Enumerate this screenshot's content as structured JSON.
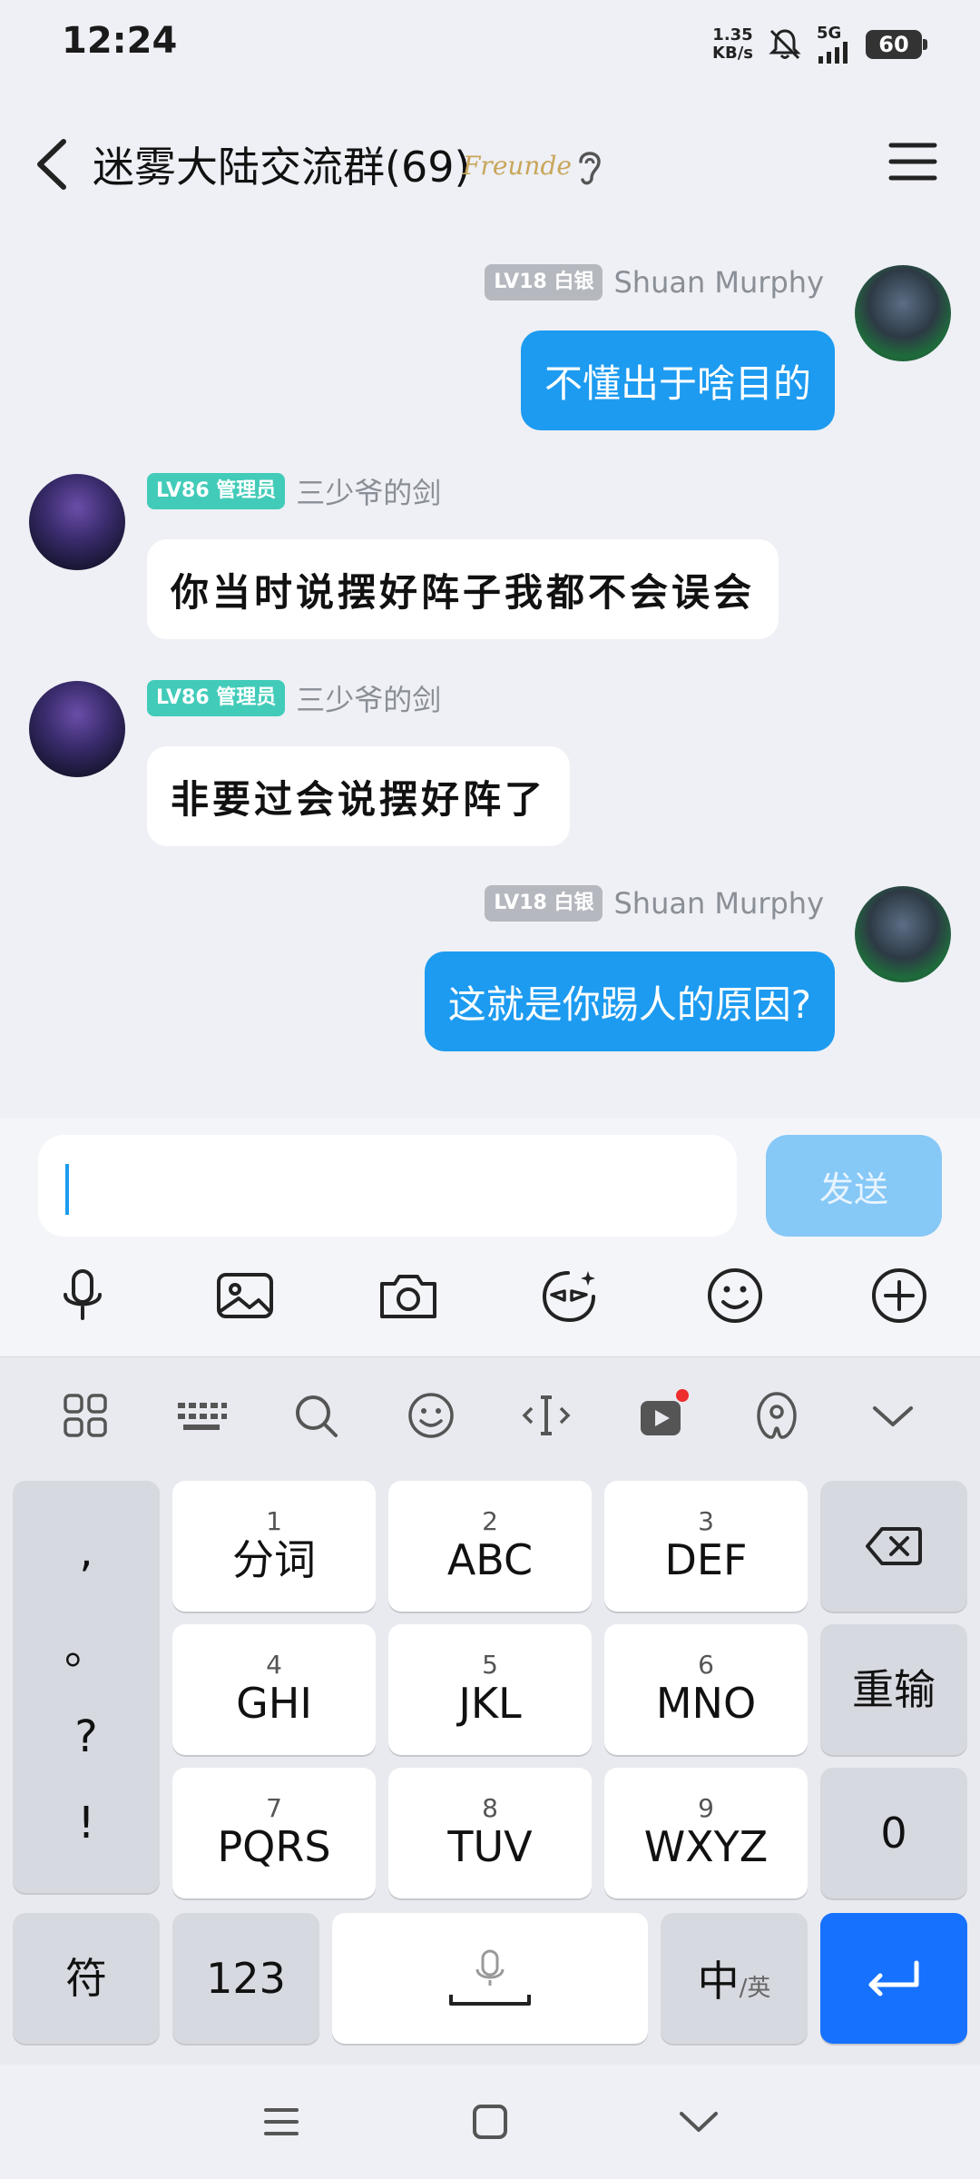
{
  "status": {
    "time": "12:24",
    "net_speed_value": "1.35",
    "net_speed_unit": "KB/s",
    "network": "5G",
    "battery": "60"
  },
  "header": {
    "title": "迷雾大陆交流群(69)",
    "tag": "Freunde"
  },
  "messages": [
    {
      "side": "right",
      "level": "LV18 白银",
      "name": "Shuan Murphy",
      "text": "不懂出于啥目的"
    },
    {
      "side": "left",
      "level": "LV86 管理员",
      "name": "三少爷的剑",
      "text": "你当时说摆好阵子我都不会误会"
    },
    {
      "side": "left",
      "level": "LV86 管理员",
      "name": "三少爷的剑",
      "text": "非要过会说摆好阵了"
    },
    {
      "side": "right",
      "level": "LV18 白银",
      "name": "Shuan Murphy",
      "text": "这就是你踢人的原因?"
    }
  ],
  "input": {
    "send_label": "发送"
  },
  "tools": [
    "microphone-icon",
    "image-icon",
    "camera-icon",
    "sticker-icon",
    "smiley-icon",
    "plus-icon"
  ],
  "keyboard": {
    "toolbar": [
      "grid-icon",
      "keyboard-icon",
      "search-icon",
      "emoji-icon",
      "cursor-icon",
      "video-ad-icon",
      "handle-icon",
      "collapse-icon"
    ],
    "punct": [
      ",",
      "。",
      "?",
      "!"
    ],
    "keys": [
      {
        "num": "1",
        "label": "分词"
      },
      {
        "num": "2",
        "label": "ABC"
      },
      {
        "num": "3",
        "label": "DEF"
      },
      {
        "num": "4",
        "label": "GHI"
      },
      {
        "num": "5",
        "label": "JKL"
      },
      {
        "num": "6",
        "label": "MNO"
      },
      {
        "num": "7",
        "label": "PQRS"
      },
      {
        "num": "8",
        "label": "TUV"
      },
      {
        "num": "9",
        "label": "WXYZ"
      }
    ],
    "reenter": "重输",
    "zero": "0",
    "symbol": "符",
    "numeric": "123",
    "lang_main": "中",
    "lang_sub": "/英"
  },
  "colors": {
    "accent": "#1d9bf0",
    "enter": "#1671ff",
    "admin_badge": "#42cbb9",
    "silver_badge": "#b5b8bf"
  }
}
